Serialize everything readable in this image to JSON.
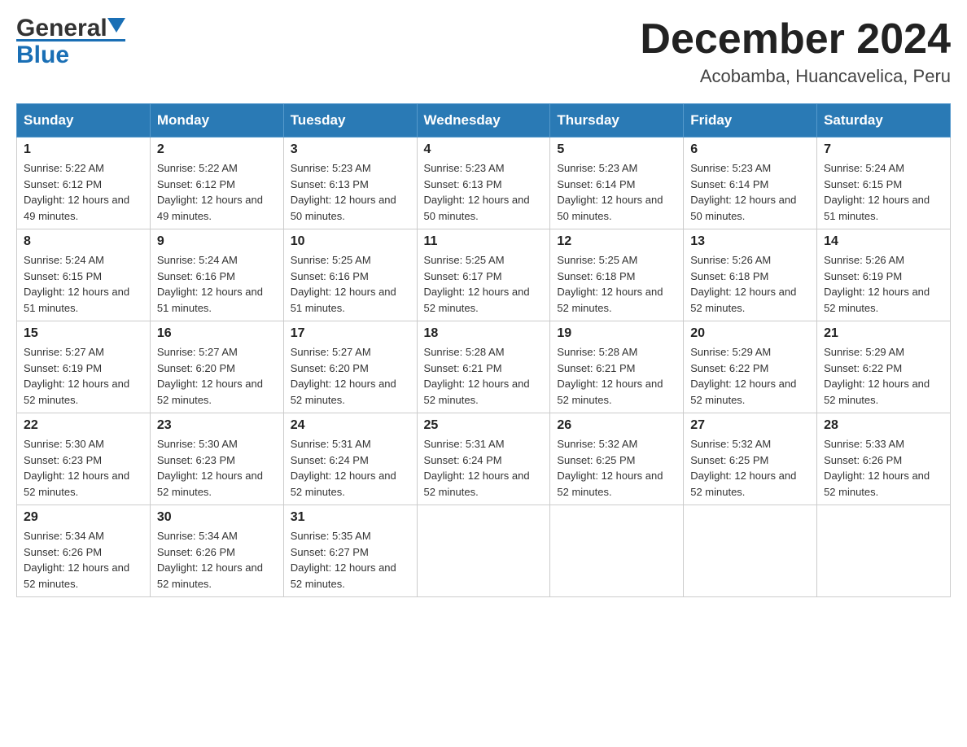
{
  "logo": {
    "general": "General",
    "blue": "Blue"
  },
  "title": {
    "month": "December 2024",
    "location": "Acobamba, Huancavelica, Peru"
  },
  "weekdays": [
    "Sunday",
    "Monday",
    "Tuesday",
    "Wednesday",
    "Thursday",
    "Friday",
    "Saturday"
  ],
  "weeks": [
    [
      {
        "day": "1",
        "sunrise": "5:22 AM",
        "sunset": "6:12 PM",
        "daylight": "12 hours and 49 minutes."
      },
      {
        "day": "2",
        "sunrise": "5:22 AM",
        "sunset": "6:12 PM",
        "daylight": "12 hours and 49 minutes."
      },
      {
        "day": "3",
        "sunrise": "5:23 AM",
        "sunset": "6:13 PM",
        "daylight": "12 hours and 50 minutes."
      },
      {
        "day": "4",
        "sunrise": "5:23 AM",
        "sunset": "6:13 PM",
        "daylight": "12 hours and 50 minutes."
      },
      {
        "day": "5",
        "sunrise": "5:23 AM",
        "sunset": "6:14 PM",
        "daylight": "12 hours and 50 minutes."
      },
      {
        "day": "6",
        "sunrise": "5:23 AM",
        "sunset": "6:14 PM",
        "daylight": "12 hours and 50 minutes."
      },
      {
        "day": "7",
        "sunrise": "5:24 AM",
        "sunset": "6:15 PM",
        "daylight": "12 hours and 51 minutes."
      }
    ],
    [
      {
        "day": "8",
        "sunrise": "5:24 AM",
        "sunset": "6:15 PM",
        "daylight": "12 hours and 51 minutes."
      },
      {
        "day": "9",
        "sunrise": "5:24 AM",
        "sunset": "6:16 PM",
        "daylight": "12 hours and 51 minutes."
      },
      {
        "day": "10",
        "sunrise": "5:25 AM",
        "sunset": "6:16 PM",
        "daylight": "12 hours and 51 minutes."
      },
      {
        "day": "11",
        "sunrise": "5:25 AM",
        "sunset": "6:17 PM",
        "daylight": "12 hours and 52 minutes."
      },
      {
        "day": "12",
        "sunrise": "5:25 AM",
        "sunset": "6:18 PM",
        "daylight": "12 hours and 52 minutes."
      },
      {
        "day": "13",
        "sunrise": "5:26 AM",
        "sunset": "6:18 PM",
        "daylight": "12 hours and 52 minutes."
      },
      {
        "day": "14",
        "sunrise": "5:26 AM",
        "sunset": "6:19 PM",
        "daylight": "12 hours and 52 minutes."
      }
    ],
    [
      {
        "day": "15",
        "sunrise": "5:27 AM",
        "sunset": "6:19 PM",
        "daylight": "12 hours and 52 minutes."
      },
      {
        "day": "16",
        "sunrise": "5:27 AM",
        "sunset": "6:20 PM",
        "daylight": "12 hours and 52 minutes."
      },
      {
        "day": "17",
        "sunrise": "5:27 AM",
        "sunset": "6:20 PM",
        "daylight": "12 hours and 52 minutes."
      },
      {
        "day": "18",
        "sunrise": "5:28 AM",
        "sunset": "6:21 PM",
        "daylight": "12 hours and 52 minutes."
      },
      {
        "day": "19",
        "sunrise": "5:28 AM",
        "sunset": "6:21 PM",
        "daylight": "12 hours and 52 minutes."
      },
      {
        "day": "20",
        "sunrise": "5:29 AM",
        "sunset": "6:22 PM",
        "daylight": "12 hours and 52 minutes."
      },
      {
        "day": "21",
        "sunrise": "5:29 AM",
        "sunset": "6:22 PM",
        "daylight": "12 hours and 52 minutes."
      }
    ],
    [
      {
        "day": "22",
        "sunrise": "5:30 AM",
        "sunset": "6:23 PM",
        "daylight": "12 hours and 52 minutes."
      },
      {
        "day": "23",
        "sunrise": "5:30 AM",
        "sunset": "6:23 PM",
        "daylight": "12 hours and 52 minutes."
      },
      {
        "day": "24",
        "sunrise": "5:31 AM",
        "sunset": "6:24 PM",
        "daylight": "12 hours and 52 minutes."
      },
      {
        "day": "25",
        "sunrise": "5:31 AM",
        "sunset": "6:24 PM",
        "daylight": "12 hours and 52 minutes."
      },
      {
        "day": "26",
        "sunrise": "5:32 AM",
        "sunset": "6:25 PM",
        "daylight": "12 hours and 52 minutes."
      },
      {
        "day": "27",
        "sunrise": "5:32 AM",
        "sunset": "6:25 PM",
        "daylight": "12 hours and 52 minutes."
      },
      {
        "day": "28",
        "sunrise": "5:33 AM",
        "sunset": "6:26 PM",
        "daylight": "12 hours and 52 minutes."
      }
    ],
    [
      {
        "day": "29",
        "sunrise": "5:34 AM",
        "sunset": "6:26 PM",
        "daylight": "12 hours and 52 minutes."
      },
      {
        "day": "30",
        "sunrise": "5:34 AM",
        "sunset": "6:26 PM",
        "daylight": "12 hours and 52 minutes."
      },
      {
        "day": "31",
        "sunrise": "5:35 AM",
        "sunset": "6:27 PM",
        "daylight": "12 hours and 52 minutes."
      },
      null,
      null,
      null,
      null
    ]
  ],
  "labels": {
    "sunrise_prefix": "Sunrise: ",
    "sunset_prefix": "Sunset: ",
    "daylight_prefix": "Daylight: "
  }
}
